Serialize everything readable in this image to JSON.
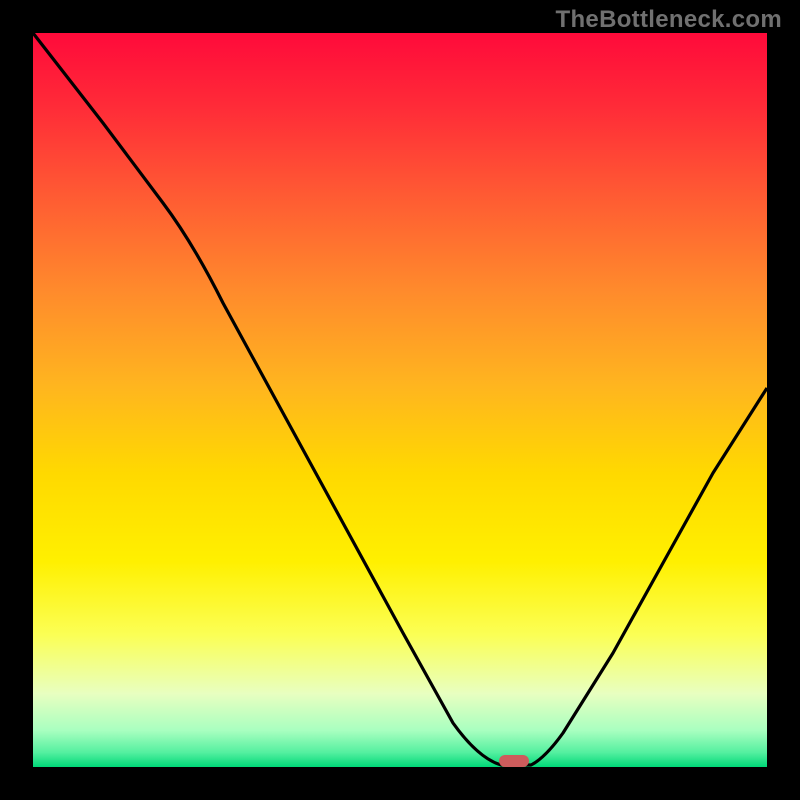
{
  "watermark": "TheBottleneck.com",
  "chart_data": {
    "type": "line",
    "title": "",
    "xlabel": "",
    "ylabel": "",
    "x": [
      0,
      5,
      10,
      15,
      20,
      25,
      30,
      35,
      40,
      45,
      50,
      55,
      60,
      62,
      65,
      68,
      70,
      75,
      80,
      85,
      90,
      95,
      100
    ],
    "values": [
      100,
      93,
      86,
      80,
      75,
      69,
      61,
      53,
      45,
      37,
      29,
      21,
      10,
      2,
      0,
      2,
      8,
      18,
      28,
      37,
      46,
      54,
      62
    ],
    "xlim": [
      0,
      100
    ],
    "ylim": [
      0,
      100
    ],
    "marker": {
      "x": 64,
      "y": 0
    },
    "background_gradient": {
      "top": "#ff003b",
      "upper_mid": "#ff7a2a",
      "mid": "#ffe200",
      "lower_mid": "#f7ffb0",
      "bottom": "#00e57a"
    }
  }
}
